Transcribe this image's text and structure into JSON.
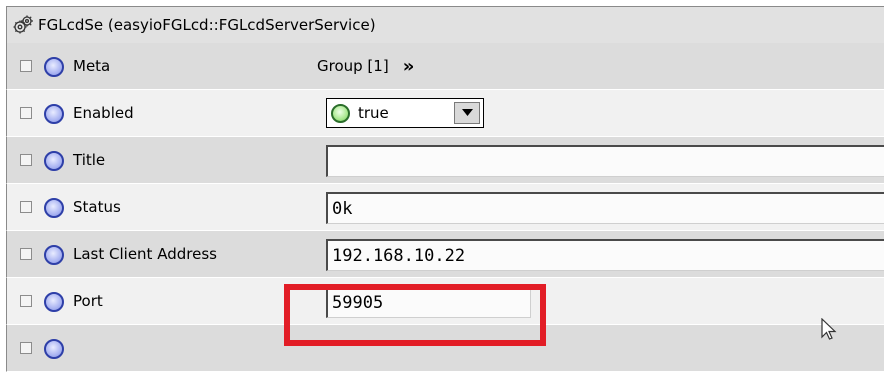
{
  "header": {
    "title": "FGLcdSe  (easyioFGLcd::FGLcdServerService)",
    "icon": "gears-icon"
  },
  "properties": [
    {
      "label": "Meta",
      "type": "group",
      "value": "Group [1]",
      "action": "»"
    },
    {
      "label": "Enabled",
      "type": "dropdown",
      "value": "true",
      "options_visible": [
        "true"
      ]
    },
    {
      "label": "Title",
      "type": "text",
      "value": ""
    },
    {
      "label": "Status",
      "type": "text",
      "value": "0k"
    },
    {
      "label": "Last Client Address",
      "type": "text",
      "value": "192.168.10.22"
    },
    {
      "label": "Port",
      "type": "text",
      "value": "59905",
      "highlighted": true
    }
  ],
  "colors": {
    "highlight": "#e21d26",
    "slot_icon": "#7d8de0",
    "enabled_icon": "#6fca57",
    "row_light": "#f1f1f1",
    "row_dark": "#dcdcdc"
  }
}
